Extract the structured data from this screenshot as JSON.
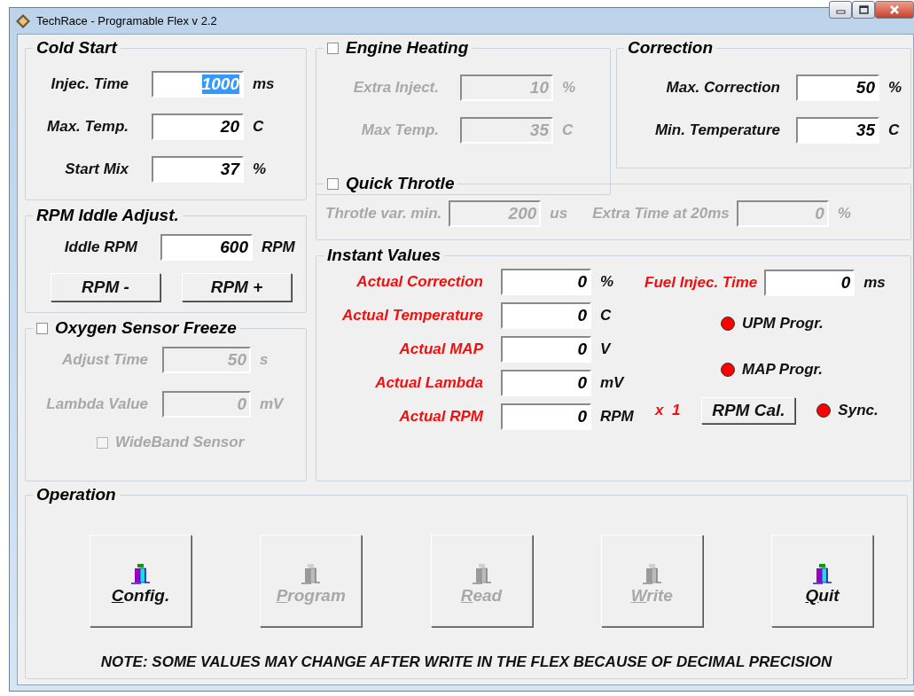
{
  "window": {
    "title": "TechRace - Programable Flex v 2.2"
  },
  "cold_start": {
    "title": "Cold Start",
    "fields": [
      {
        "label": "Injec. Time",
        "value": "1000",
        "unit": "ms",
        "focused": true
      },
      {
        "label": "Max. Temp.",
        "value": "20",
        "unit": "C",
        "focused": false
      },
      {
        "label": "Start Mix",
        "value": "37",
        "unit": "%",
        "focused": false
      }
    ]
  },
  "engine_heating": {
    "title": "Engine Heating",
    "checked": false,
    "fields": [
      {
        "label": "Extra Inject.",
        "value": "10",
        "unit": "%",
        "disabled": true
      },
      {
        "label": "Max Temp.",
        "value": "35",
        "unit": "C",
        "disabled": true
      }
    ]
  },
  "correction": {
    "title": "Correction",
    "fields": [
      {
        "label": "Max. Correction",
        "value": "50",
        "unit": "%",
        "disabled": false
      },
      {
        "label": "Min. Temperature",
        "value": "35",
        "unit": "C",
        "disabled": false
      }
    ]
  },
  "quick_throttle": {
    "title": "Quick Throtle",
    "checked": false,
    "fields": [
      {
        "label": "Throtle var. min.",
        "value": "200",
        "unit": "us",
        "disabled": true
      },
      {
        "label": "Extra Time at 20ms",
        "value": "0",
        "unit": "%",
        "disabled": true
      }
    ]
  },
  "rpm_idle": {
    "title": "RPM Iddle Adjust.",
    "field": {
      "label": "Iddle RPM",
      "value": "600",
      "unit": "RPM"
    },
    "buttons": [
      {
        "label": "RPM -"
      },
      {
        "label": "RPM +"
      }
    ]
  },
  "instant_values": {
    "title": "Instant Values",
    "fields": [
      {
        "label": "Actual Correction",
        "value": "0",
        "unit": "%"
      },
      {
        "label": "Actual Temperature",
        "value": "0",
        "unit": "C"
      },
      {
        "label": "Actual MAP",
        "value": "0",
        "unit": "V"
      },
      {
        "label": "Actual Lambda",
        "value": "0",
        "unit": "mV"
      },
      {
        "label": "Actual RPM",
        "value": "0",
        "unit": "RPM"
      }
    ],
    "fuel": {
      "label": "Fuel Injec. Time",
      "value": "0",
      "unit": "ms"
    },
    "indicators": [
      {
        "label": "UPM Progr.",
        "color": "#ff0000"
      },
      {
        "label": "MAP Progr.",
        "color": "#ff0000"
      }
    ],
    "multiplier": "x  1",
    "calibrate_button": "RPM Cal.",
    "sync": {
      "label": "Sync.",
      "color": "#ff0000"
    }
  },
  "oxygen_sensor": {
    "title": "Oxygen Sensor Freeze",
    "checked": false,
    "fields": [
      {
        "label": "Adjust Time",
        "value": "50",
        "unit": "s",
        "disabled": true
      },
      {
        "label": "Lambda Value",
        "value": "0",
        "unit": "mV",
        "disabled": true
      }
    ],
    "wideband": {
      "label": "WideBand Sensor",
      "checked": false,
      "disabled": true
    }
  },
  "operation": {
    "title": "Operation",
    "buttons": [
      {
        "label": "Config.",
        "disabled": false
      },
      {
        "label": "Program",
        "disabled": true
      },
      {
        "label": "Read",
        "disabled": true
      },
      {
        "label": "Write",
        "disabled": true
      },
      {
        "label": "Quit",
        "disabled": false
      }
    ],
    "note": "NOTE: SOME VALUES MAY CHANGE AFTER WRITE IN THE FLEX BECAUSE OF DECIMAL PRECISION"
  }
}
